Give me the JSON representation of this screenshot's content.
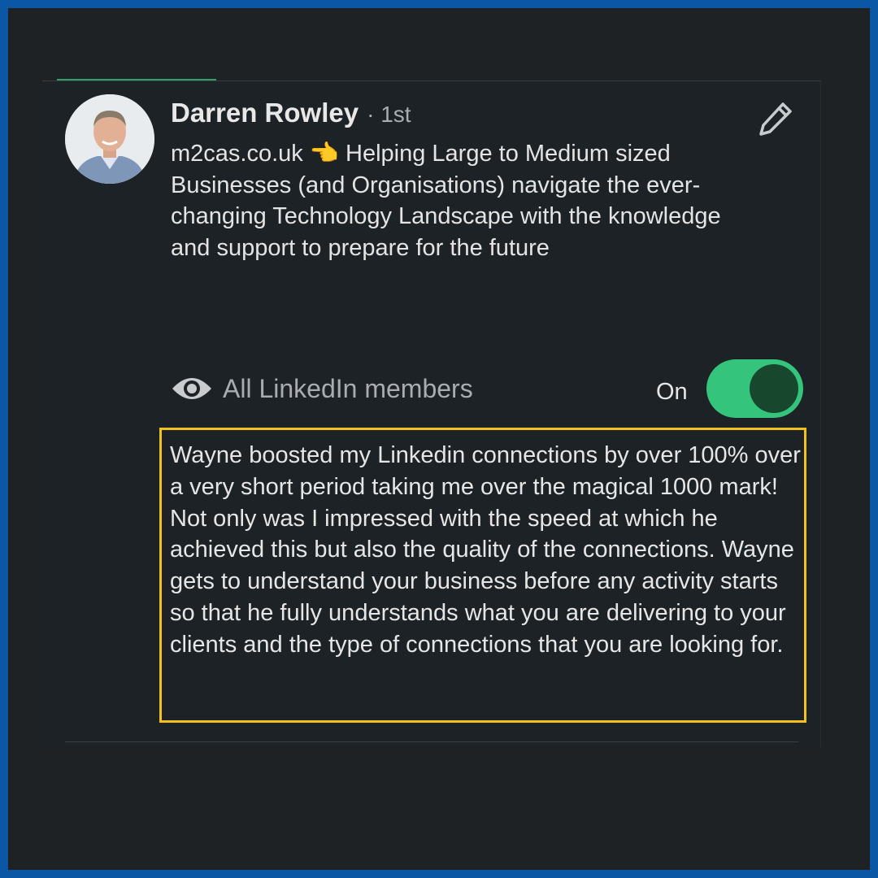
{
  "profile": {
    "name": "Darren Rowley",
    "degree": "· 1st",
    "headline": "m2cas.co.uk 👈 Helping Large to Medium sized Businesses (and Organisations) navigate the ever-changing Technology Landscape with the knowledge and support to prepare for the future"
  },
  "icons": {
    "edit": "pencil-icon",
    "visibility": "eye-icon"
  },
  "visibility": {
    "label": "All LinkedIn members",
    "state": "On",
    "enabled": true
  },
  "recommendation": {
    "text": "Wayne boosted my Linkedin connections by over 100% over a very short period taking me over the magical 1000 mark! Not only was I impressed with the speed at which he achieved this but also the quality of the connections. Wayne gets to understand your business before any activity starts so that he fully understands what you are delivering to your clients and the type of connections that you are looking for."
  },
  "colors": {
    "border_blue": "#0b57a6",
    "background": "#1f2225",
    "toggle_green": "#35c47c",
    "highlight_yellow": "#f3c21f"
  }
}
